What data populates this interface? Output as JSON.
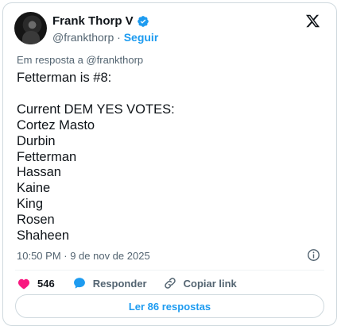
{
  "author": {
    "name": "Frank Thorp V",
    "handle": "@frankthorp",
    "separator": " · ",
    "follow_label": "Seguir"
  },
  "reply_context": "Em resposta a @frankthorp",
  "tweet_text": "Fetterman is #8:\n\nCurrent DEM YES VOTES:\nCortez Masto\nDurbin\nFetterman\nHassan\nKaine\nKing\nRosen\nShaheen",
  "timestamp": "10:50 PM · 9 de nov de 2025",
  "actions": {
    "likes_count": "546",
    "reply_label": "Responder",
    "copy_link_label": "Copiar link"
  },
  "read_replies_label": "Ler 86 respostas",
  "colors": {
    "accent": "#1d9bf0",
    "like": "#f91880",
    "muted": "#536471"
  },
  "icons": [
    "verified-badge-icon",
    "x-logo-icon",
    "info-icon",
    "heart-icon",
    "reply-bubble-icon",
    "link-icon"
  ]
}
